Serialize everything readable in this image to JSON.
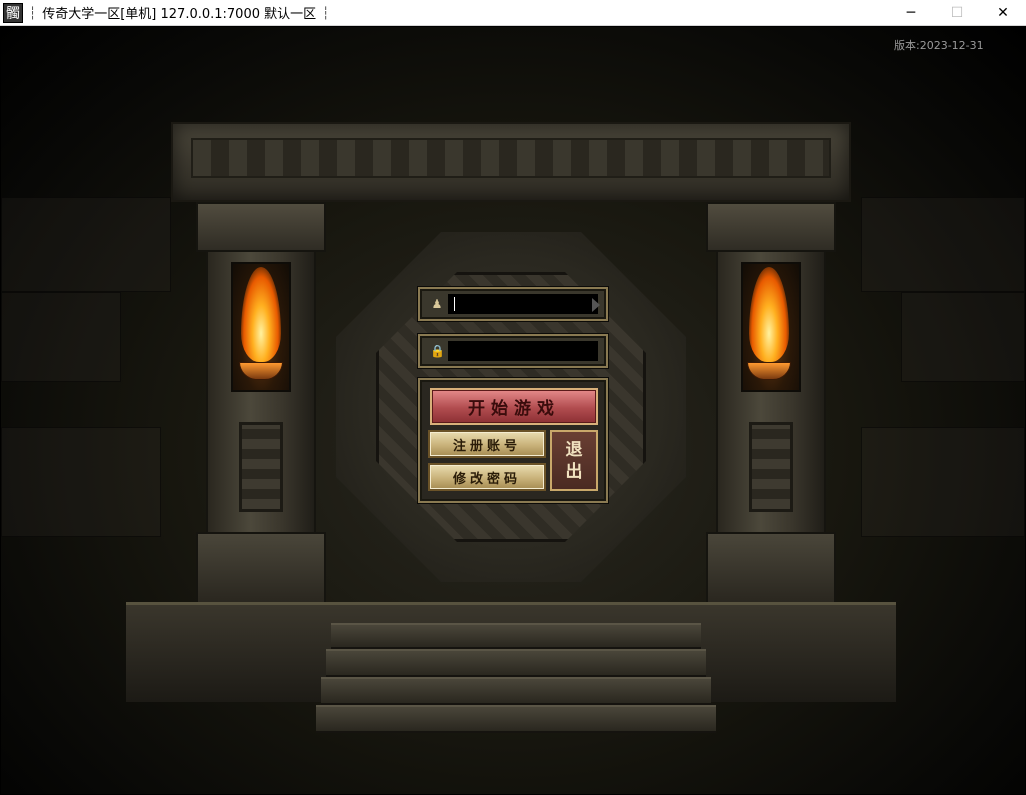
{
  "window": {
    "icon_glyph": "髑",
    "separator": "┆",
    "title": "传奇大学一区[单机] 127.0.0.1:7000  默认一区",
    "tail": "┆",
    "minimize_glyph": "─",
    "maximize_glyph": "☐",
    "close_glyph": "✕"
  },
  "game": {
    "version": "版本:2023-12-31"
  },
  "login": {
    "account_icon": "user-icon",
    "account_icon_glyph": "♟",
    "account_value": "",
    "password_icon": "lock-icon",
    "password_icon_glyph": "🔒",
    "password_value": "",
    "start_label": "开始游戏",
    "register_label": "注册账号",
    "change_password_label": "修改密码",
    "exit_label_line1": "退",
    "exit_label_line2": "出"
  },
  "colors": {
    "start_button": "#b14c4f",
    "small_button": "#c9b27a",
    "exit_button": "#4a2a22",
    "panel_border": "#8a7a52",
    "flame": "#ffb020"
  }
}
